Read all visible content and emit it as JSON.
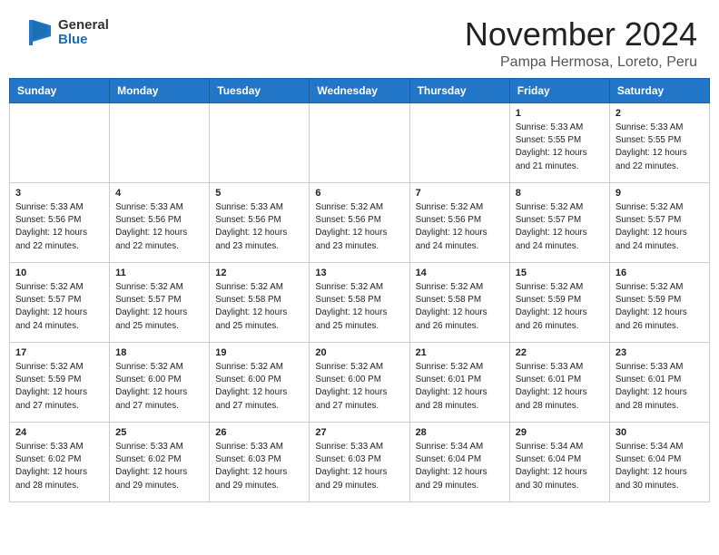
{
  "header": {
    "logo_general": "General",
    "logo_blue": "Blue",
    "month": "November 2024",
    "location": "Pampa Hermosa, Loreto, Peru"
  },
  "weekdays": [
    "Sunday",
    "Monday",
    "Tuesday",
    "Wednesday",
    "Thursday",
    "Friday",
    "Saturday"
  ],
  "weeks": [
    [
      {
        "day": "",
        "info": ""
      },
      {
        "day": "",
        "info": ""
      },
      {
        "day": "",
        "info": ""
      },
      {
        "day": "",
        "info": ""
      },
      {
        "day": "",
        "info": ""
      },
      {
        "day": "1",
        "info": "Sunrise: 5:33 AM\nSunset: 5:55 PM\nDaylight: 12 hours\nand 21 minutes."
      },
      {
        "day": "2",
        "info": "Sunrise: 5:33 AM\nSunset: 5:55 PM\nDaylight: 12 hours\nand 22 minutes."
      }
    ],
    [
      {
        "day": "3",
        "info": "Sunrise: 5:33 AM\nSunset: 5:56 PM\nDaylight: 12 hours\nand 22 minutes."
      },
      {
        "day": "4",
        "info": "Sunrise: 5:33 AM\nSunset: 5:56 PM\nDaylight: 12 hours\nand 22 minutes."
      },
      {
        "day": "5",
        "info": "Sunrise: 5:33 AM\nSunset: 5:56 PM\nDaylight: 12 hours\nand 23 minutes."
      },
      {
        "day": "6",
        "info": "Sunrise: 5:32 AM\nSunset: 5:56 PM\nDaylight: 12 hours\nand 23 minutes."
      },
      {
        "day": "7",
        "info": "Sunrise: 5:32 AM\nSunset: 5:56 PM\nDaylight: 12 hours\nand 24 minutes."
      },
      {
        "day": "8",
        "info": "Sunrise: 5:32 AM\nSunset: 5:57 PM\nDaylight: 12 hours\nand 24 minutes."
      },
      {
        "day": "9",
        "info": "Sunrise: 5:32 AM\nSunset: 5:57 PM\nDaylight: 12 hours\nand 24 minutes."
      }
    ],
    [
      {
        "day": "10",
        "info": "Sunrise: 5:32 AM\nSunset: 5:57 PM\nDaylight: 12 hours\nand 24 minutes."
      },
      {
        "day": "11",
        "info": "Sunrise: 5:32 AM\nSunset: 5:57 PM\nDaylight: 12 hours\nand 25 minutes."
      },
      {
        "day": "12",
        "info": "Sunrise: 5:32 AM\nSunset: 5:58 PM\nDaylight: 12 hours\nand 25 minutes."
      },
      {
        "day": "13",
        "info": "Sunrise: 5:32 AM\nSunset: 5:58 PM\nDaylight: 12 hours\nand 25 minutes."
      },
      {
        "day": "14",
        "info": "Sunrise: 5:32 AM\nSunset: 5:58 PM\nDaylight: 12 hours\nand 26 minutes."
      },
      {
        "day": "15",
        "info": "Sunrise: 5:32 AM\nSunset: 5:59 PM\nDaylight: 12 hours\nand 26 minutes."
      },
      {
        "day": "16",
        "info": "Sunrise: 5:32 AM\nSunset: 5:59 PM\nDaylight: 12 hours\nand 26 minutes."
      }
    ],
    [
      {
        "day": "17",
        "info": "Sunrise: 5:32 AM\nSunset: 5:59 PM\nDaylight: 12 hours\nand 27 minutes."
      },
      {
        "day": "18",
        "info": "Sunrise: 5:32 AM\nSunset: 6:00 PM\nDaylight: 12 hours\nand 27 minutes."
      },
      {
        "day": "19",
        "info": "Sunrise: 5:32 AM\nSunset: 6:00 PM\nDaylight: 12 hours\nand 27 minutes."
      },
      {
        "day": "20",
        "info": "Sunrise: 5:32 AM\nSunset: 6:00 PM\nDaylight: 12 hours\nand 27 minutes."
      },
      {
        "day": "21",
        "info": "Sunrise: 5:32 AM\nSunset: 6:01 PM\nDaylight: 12 hours\nand 28 minutes."
      },
      {
        "day": "22",
        "info": "Sunrise: 5:33 AM\nSunset: 6:01 PM\nDaylight: 12 hours\nand 28 minutes."
      },
      {
        "day": "23",
        "info": "Sunrise: 5:33 AM\nSunset: 6:01 PM\nDaylight: 12 hours\nand 28 minutes."
      }
    ],
    [
      {
        "day": "24",
        "info": "Sunrise: 5:33 AM\nSunset: 6:02 PM\nDaylight: 12 hours\nand 28 minutes."
      },
      {
        "day": "25",
        "info": "Sunrise: 5:33 AM\nSunset: 6:02 PM\nDaylight: 12 hours\nand 29 minutes."
      },
      {
        "day": "26",
        "info": "Sunrise: 5:33 AM\nSunset: 6:03 PM\nDaylight: 12 hours\nand 29 minutes."
      },
      {
        "day": "27",
        "info": "Sunrise: 5:33 AM\nSunset: 6:03 PM\nDaylight: 12 hours\nand 29 minutes."
      },
      {
        "day": "28",
        "info": "Sunrise: 5:34 AM\nSunset: 6:04 PM\nDaylight: 12 hours\nand 29 minutes."
      },
      {
        "day": "29",
        "info": "Sunrise: 5:34 AM\nSunset: 6:04 PM\nDaylight: 12 hours\nand 30 minutes."
      },
      {
        "day": "30",
        "info": "Sunrise: 5:34 AM\nSunset: 6:04 PM\nDaylight: 12 hours\nand 30 minutes."
      }
    ]
  ]
}
